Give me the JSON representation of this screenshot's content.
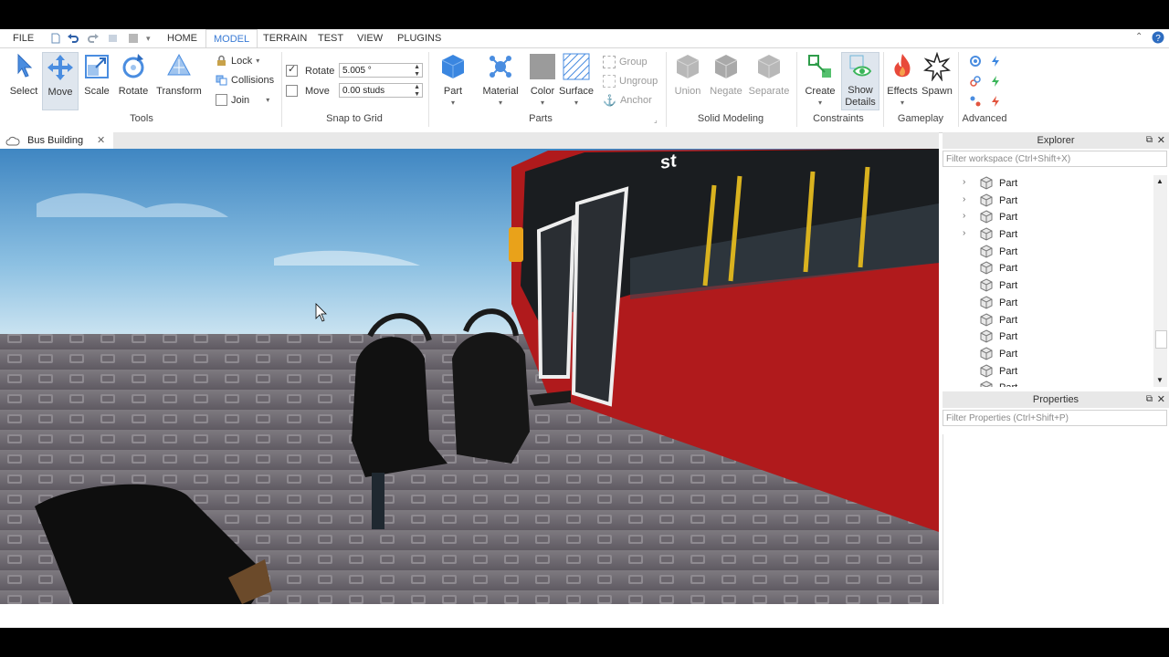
{
  "menu": {
    "file": "FILE",
    "tabs": [
      "HOME",
      "MODEL",
      "TERRAIN",
      "TEST",
      "VIEW",
      "PLUGINS"
    ],
    "active_tab": "MODEL"
  },
  "ribbon": {
    "tools": {
      "label": "Tools",
      "select": "Select",
      "move": "Move",
      "scale": "Scale",
      "rotate": "Rotate",
      "transform": "Transform",
      "lock": "Lock",
      "collisions": "Collisions",
      "join": "Join"
    },
    "snap": {
      "label": "Snap to Grid",
      "rotate_label": "Rotate",
      "rotate_value": "5.005 °",
      "move_label": "Move",
      "move_value": "0.00 studs"
    },
    "parts": {
      "label": "Parts",
      "part": "Part",
      "material": "Material",
      "color": "Color",
      "surface": "Surface",
      "group": "Group",
      "ungroup": "Ungroup",
      "anchor": "Anchor"
    },
    "solid": {
      "label": "Solid Modeling",
      "union": "Union",
      "negate": "Negate",
      "separate": "Separate"
    },
    "constraints": {
      "label": "Constraints",
      "create": "Create",
      "show": "Show",
      "details": "Details"
    },
    "gameplay": {
      "label": "Gameplay",
      "effects": "Effects",
      "spawn": "Spawn"
    },
    "advanced": {
      "label": "Advanced"
    }
  },
  "document": {
    "tab_title": "Bus Building"
  },
  "explorer": {
    "title": "Explorer",
    "filter_placeholder": "Filter workspace (Ctrl+Shift+X)",
    "items": [
      {
        "label": "Part",
        "expandable": true
      },
      {
        "label": "Part",
        "expandable": true
      },
      {
        "label": "Part",
        "expandable": true
      },
      {
        "label": "Part",
        "expandable": true
      },
      {
        "label": "Part",
        "expandable": false
      },
      {
        "label": "Part",
        "expandable": false
      },
      {
        "label": "Part",
        "expandable": false
      },
      {
        "label": "Part",
        "expandable": false
      },
      {
        "label": "Part",
        "expandable": false
      },
      {
        "label": "Part",
        "expandable": false
      },
      {
        "label": "Part",
        "expandable": false
      },
      {
        "label": "Part",
        "expandable": false
      },
      {
        "label": "Part",
        "expandable": false
      }
    ]
  },
  "properties": {
    "title": "Properties",
    "filter_placeholder": "Filter Properties (Ctrl+Shift+P)"
  },
  "colors": {
    "accent": "#3a7bd5",
    "bus_red": "#b01a1c",
    "sky_top": "#4a90c8",
    "floor": "#6f6a70"
  }
}
